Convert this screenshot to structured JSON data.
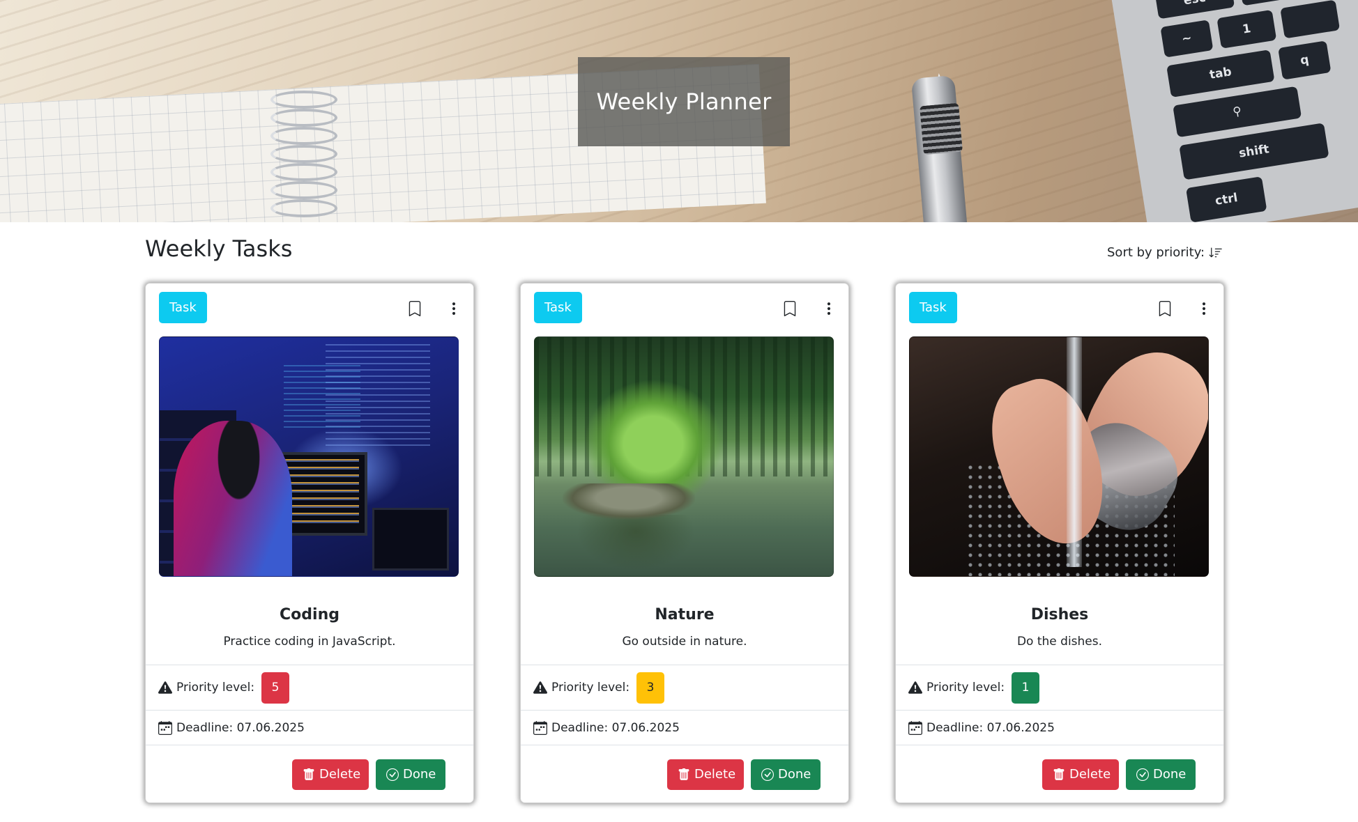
{
  "hero": {
    "title": "Weekly Planner"
  },
  "section": {
    "title": "Weekly Tasks",
    "sort_label": "Sort by priority:"
  },
  "keyboard": {
    "keys": [
      "esc",
      "tab",
      "shift",
      "ctrl"
    ]
  },
  "colors": {
    "badge_task": "#0dcaf0",
    "danger": "#dc3545",
    "warning": "#ffc107",
    "success": "#198754"
  },
  "cards": [
    {
      "badge": "Task",
      "title": "Coding",
      "text": "Practice coding in JavaScript.",
      "priority_label": "Priority level:",
      "priority": "5",
      "deadline": "Deadline: 07.06.2025",
      "delete_label": "Delete",
      "done_label": "Done"
    },
    {
      "badge": "Task",
      "title": "Nature",
      "text": "Go outside in nature.",
      "priority_label": "Priority level:",
      "priority": "3",
      "deadline": "Deadline: 07.06.2025",
      "delete_label": "Delete",
      "done_label": "Done"
    },
    {
      "badge": "Task",
      "title": "Dishes",
      "text": "Do the dishes.",
      "priority_label": "Priority level:",
      "priority": "1",
      "deadline": "Deadline: 07.06.2025",
      "delete_label": "Delete",
      "done_label": "Done"
    }
  ]
}
